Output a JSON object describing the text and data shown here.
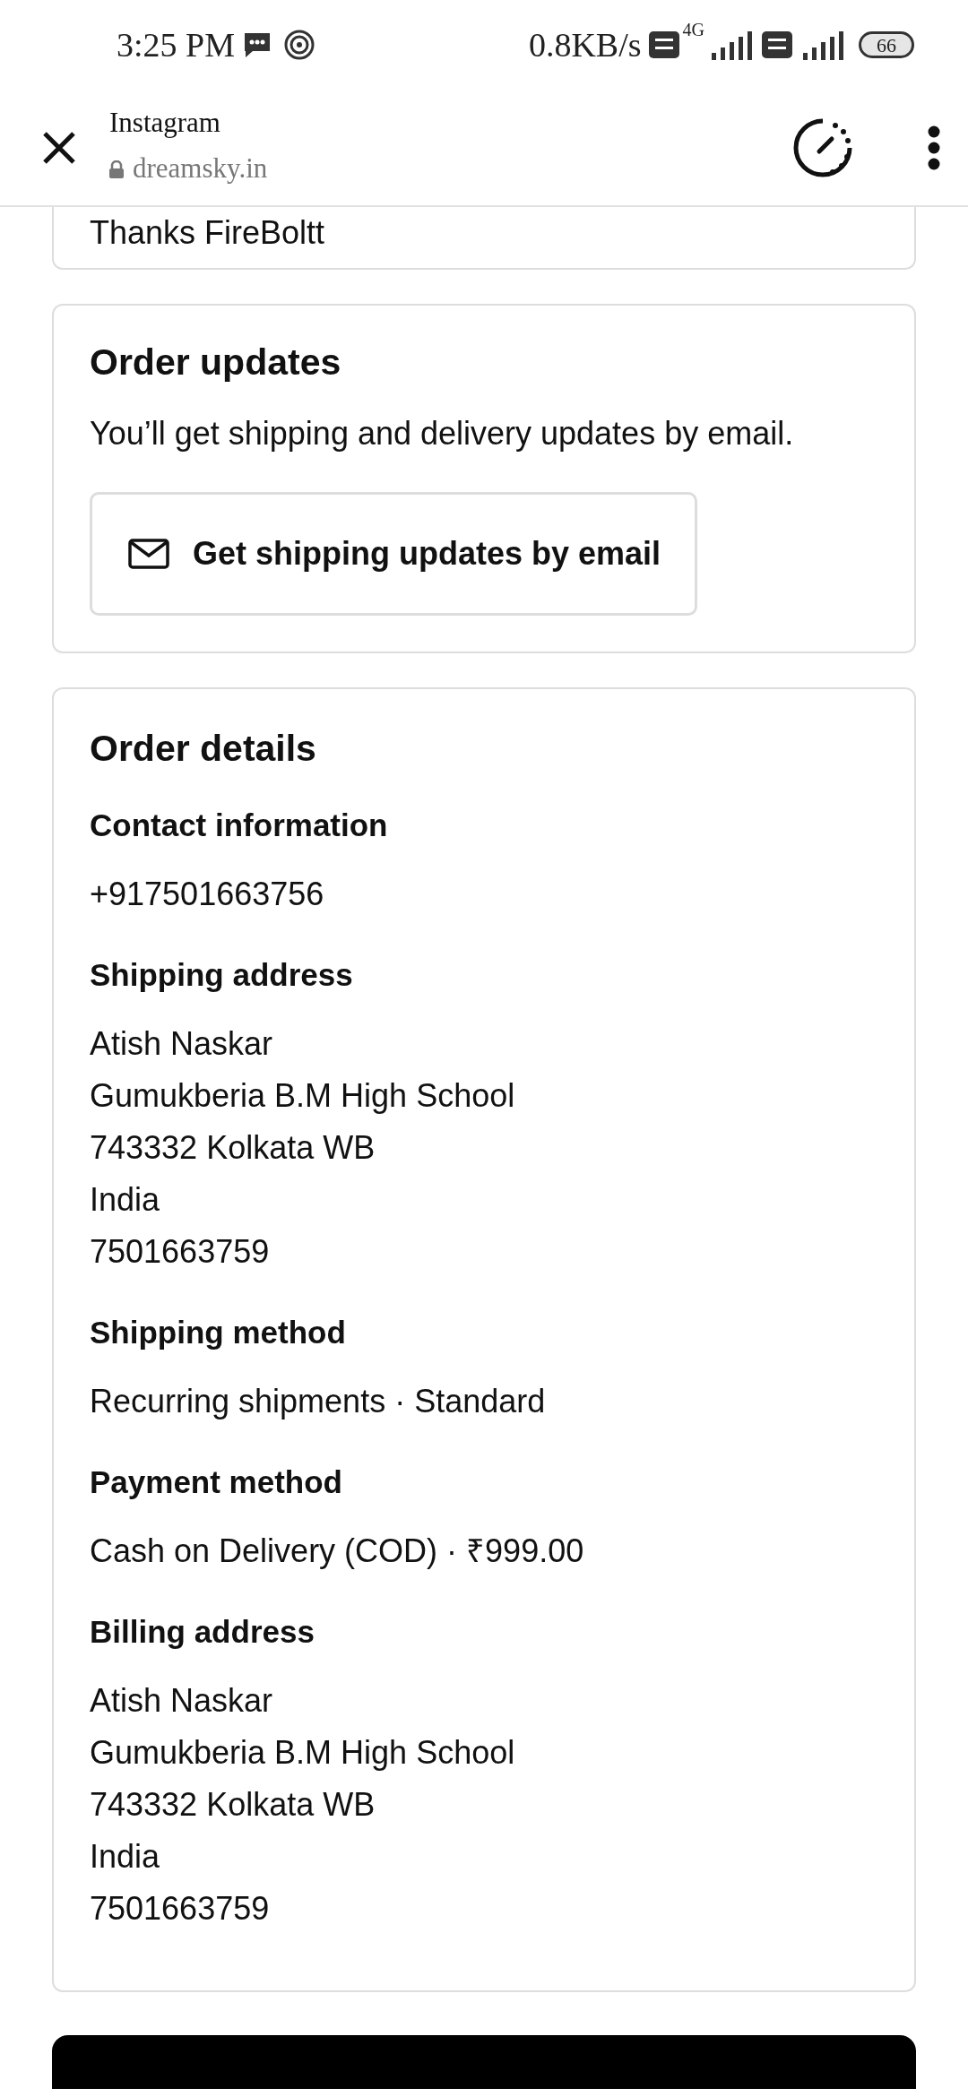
{
  "status_bar": {
    "time": "3:25 PM",
    "network_speed": "0.8KB/s",
    "network_type": "4G",
    "battery": "66"
  },
  "header": {
    "app_name": "Instagram",
    "url": "dreamsky.in"
  },
  "previous_card": {
    "text": "Thanks FireBoltt"
  },
  "order_updates": {
    "title": "Order updates",
    "text": "You’ll get shipping and delivery updates by email.",
    "button": "Get shipping updates by email"
  },
  "order_details": {
    "title": "Order details",
    "sections": [
      {
        "label": "Contact information",
        "lines": [
          "+917501663756"
        ]
      },
      {
        "label": "Shipping address",
        "lines": [
          "Atish Naskar",
          "Gumukberia B.M High School",
          "743332 Kolkata WB",
          "India",
          "7501663759"
        ]
      },
      {
        "label": "Shipping method",
        "lines": [
          "Recurring shipments · Standard"
        ]
      },
      {
        "label": "Payment method",
        "lines": [
          "Cash on Delivery (COD) · ₹999.00"
        ]
      },
      {
        "label": "Billing address",
        "lines": [
          "Atish Naskar",
          "Gumukberia B.M High School",
          "743332 Kolkata WB",
          "India",
          "7501663759"
        ]
      }
    ]
  }
}
